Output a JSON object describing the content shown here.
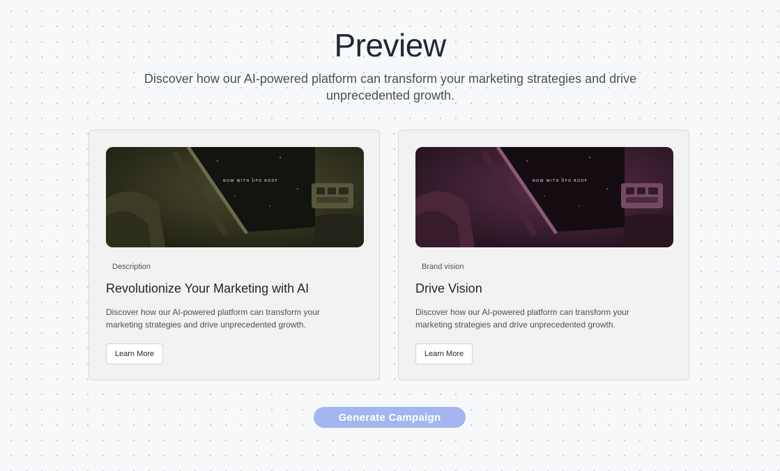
{
  "header": {
    "title": "Preview",
    "subtitle": "Discover how our AI-powered platform can transform your marketing strategies and drive unprecedented growth."
  },
  "cards": [
    {
      "tag": "Description",
      "title": "Revolutionize Your Marketing with AI",
      "description": "Discover how our AI-powered platform can transform your marketing strategies and drive unprecedented growth.",
      "image_text": "NOW WITH UFO ROOF",
      "image_tint": "#5a5a38",
      "button_label": "Learn More"
    },
    {
      "tag": "Brand vision",
      "title": "Drive Vision",
      "description": "Discover how our AI-powered platform can transform your marketing strategies and drive unprecedented growth.",
      "image_text": "NOW WITH UFO ROOF",
      "image_tint": "#6a3a58",
      "button_label": "Learn More"
    }
  ],
  "actions": {
    "generate_label": "Generate Campaign"
  },
  "colors": {
    "background": "#f7f8fa",
    "card_background": "#f2f2f2",
    "primary_button": "#a3b6ef"
  }
}
